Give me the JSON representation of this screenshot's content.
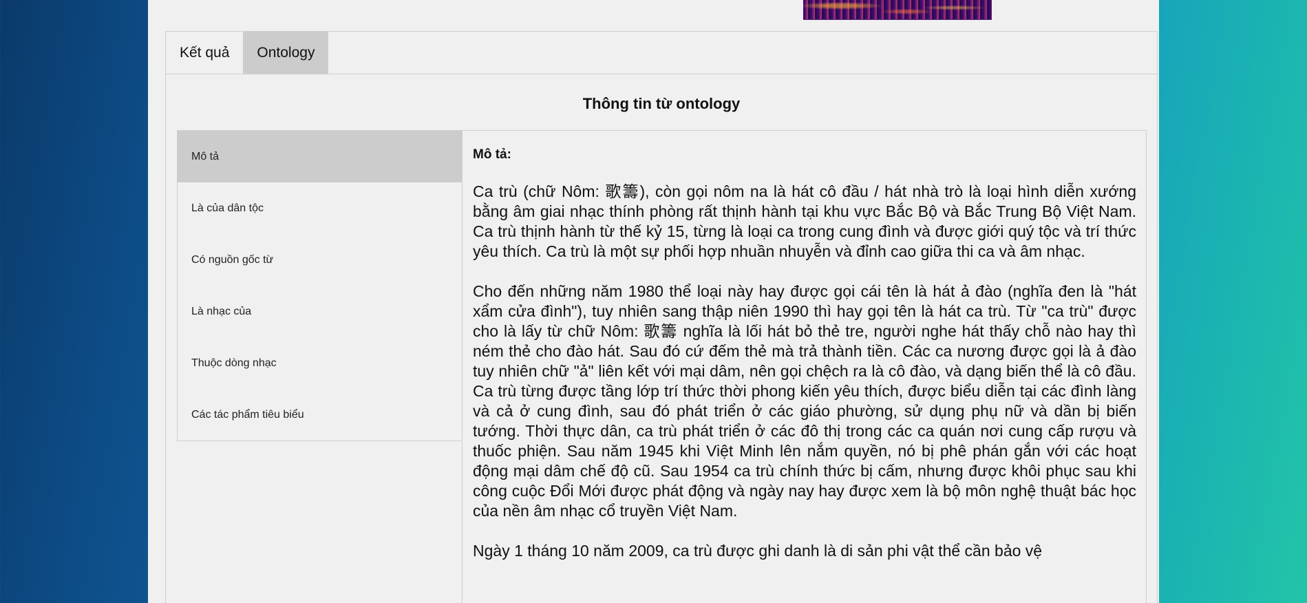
{
  "tabs": [
    {
      "label": "Kết quả"
    },
    {
      "label": "Ontology"
    }
  ],
  "section_title": "Thông tin từ ontology",
  "sidebar": {
    "items": [
      {
        "label": "Mô tả"
      },
      {
        "label": "Là của dân tộc"
      },
      {
        "label": "Có nguồn gốc từ"
      },
      {
        "label": "Là nhạc của"
      },
      {
        "label": "Thuộc dòng nhạc"
      },
      {
        "label": "Các tác phẩm tiêu biểu"
      }
    ]
  },
  "content": {
    "label": "Mô tả:",
    "paragraphs": [
      "Ca trù (chữ Nôm: 歌籌), còn gọi nôm na là hát cô đầu / hát nhà trò là loại hình diễn xướng bằng âm giai nhạc thính phòng rất thịnh hành tại khu vực Bắc Bộ và Bắc Trung Bộ Việt Nam. Ca trù thịnh hành từ thế kỷ 15, từng là loại ca trong cung đình và được giới quý tộc và trí thức yêu thích. Ca trù là một sự phối hợp nhuần nhuyễn và đỉnh cao giữa thi ca và âm nhạc.",
      "Cho đến những năm 1980 thể loại này hay được gọi cái tên là hát ả đào (nghĩa đen là \"hát xẩm cửa đình\"), tuy nhiên sang thập niên 1990 thì hay gọi tên là hát ca trù. Từ \"ca trù\" được cho là lấy từ chữ Nôm: 歌籌 nghĩa là lối hát bỏ thẻ tre, người nghe hát thấy chỗ nào hay thì ném thẻ cho đào hát. Sau đó cứ đếm thẻ mà trả thành tiền. Các ca nương được gọi là ả đào tuy nhiên chữ \"ả\" liên kết với mại dâm, nên gọi chệch ra là cô đào, và dạng biến thể là cô đầu. Ca trù từng được tầng lớp trí thức thời phong kiến yêu thích, được biểu diễn tại các đình làng và cả ở cung đình, sau đó phát triển ở các giáo phường, sử dụng phụ nữ và dần bị biến tướng. Thời thực dân, ca trù phát triển ở các đô thị trong các ca quán nơi cung cấp rượu và thuốc phiện. Sau năm 1945 khi Việt Minh lên nắm quyền, nó bị phê phán gắn với các hoạt động mại dâm chế độ cũ. Sau 1954 ca trù chính thức bị cấm, nhưng được khôi phục sau khi công cuộc Đổi Mới được phát động và ngày nay hay được xem là bộ môn nghệ thuật bác học của nền âm nhạc cổ truyền Việt Nam.",
      "Ngày 1 tháng 10 năm 2009, ca trù được ghi danh là di sản phi vật thể cần bảo vệ"
    ]
  }
}
